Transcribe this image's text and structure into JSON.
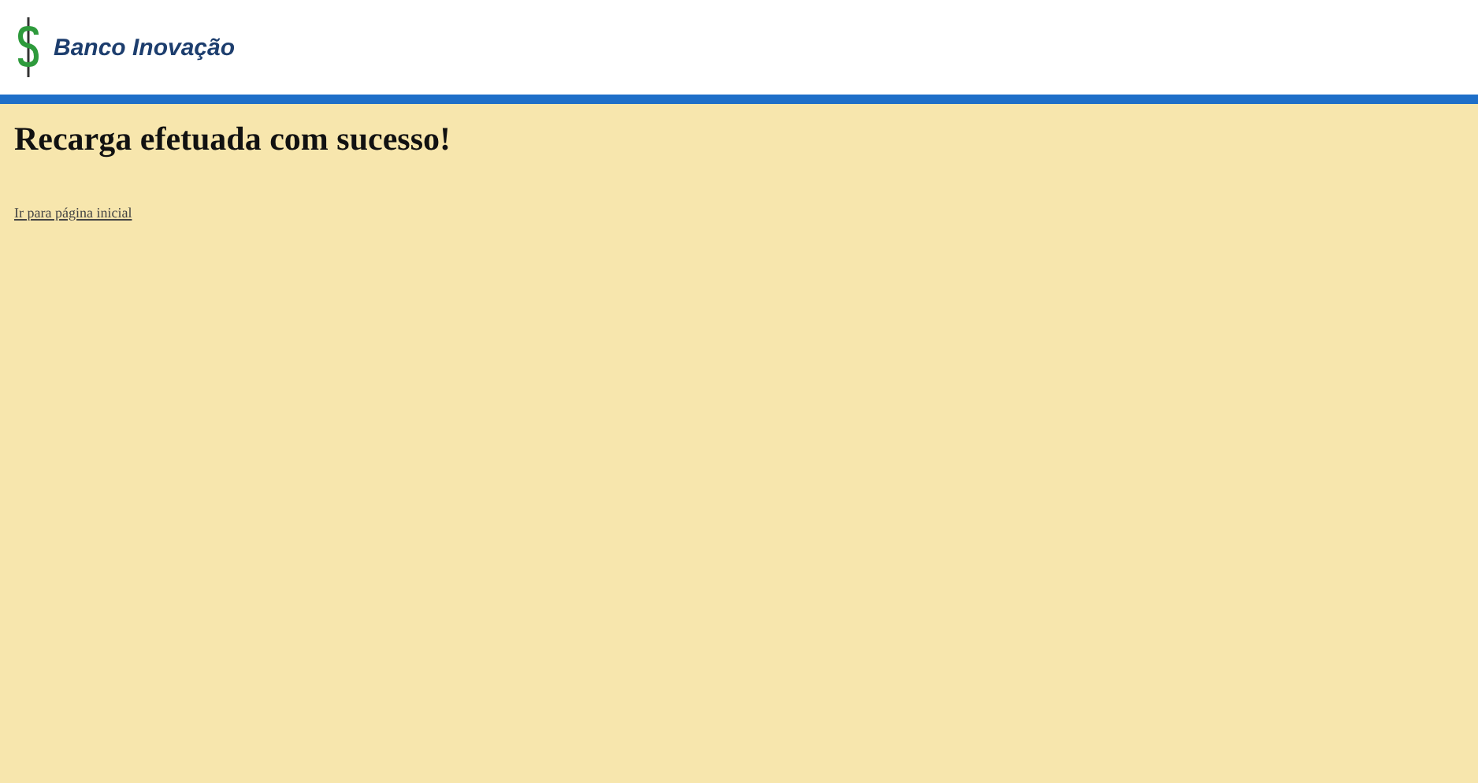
{
  "header": {
    "brand": "Banco Inovação"
  },
  "heading": "Recarga efetuada com sucesso!",
  "link": "Ir para página inicial"
}
